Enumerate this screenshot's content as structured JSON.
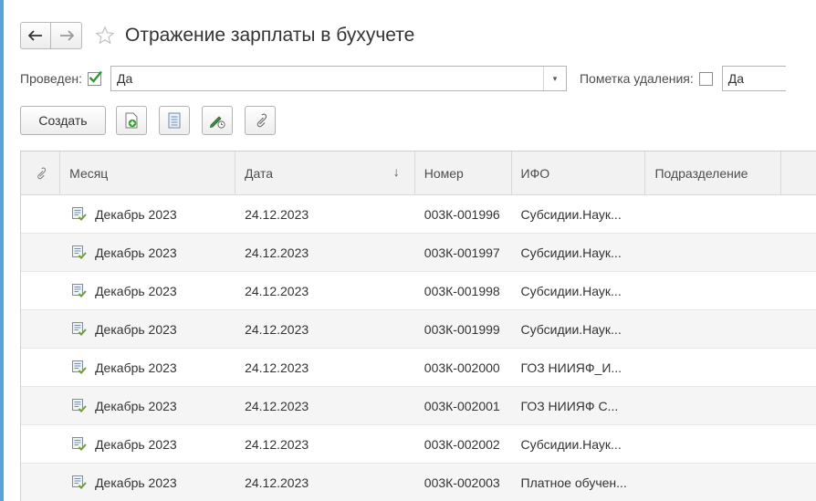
{
  "window": {
    "title": "Отражение зарплаты в бухучете"
  },
  "filters": {
    "posted_label": "Проведен:",
    "posted_checked": true,
    "posted_value": "Да",
    "deletion_label": "Пометка удаления:",
    "deletion_checked": false,
    "deletion_value": "Да"
  },
  "toolbar": {
    "create_label": "Создать",
    "icons": [
      "add-document-icon",
      "list-icon",
      "edit-date-icon",
      "attachment-icon"
    ]
  },
  "table": {
    "columns": {
      "attachment": "attachment-icon",
      "month": "Месяц",
      "date": "Дата",
      "number": "Номер",
      "ifo": "ИФО",
      "department": "Подразделение"
    },
    "sort_indicator": "↓",
    "rows": [
      {
        "month": "Декабрь 2023",
        "date": "24.12.2023",
        "number": "003К-001996",
        "ifo": "Субсидии.Наук..."
      },
      {
        "month": "Декабрь 2023",
        "date": "24.12.2023",
        "number": "003К-001997",
        "ifo": "Субсидии.Наук..."
      },
      {
        "month": "Декабрь 2023",
        "date": "24.12.2023",
        "number": "003К-001998",
        "ifo": "Субсидии.Наук..."
      },
      {
        "month": "Декабрь 2023",
        "date": "24.12.2023",
        "number": "003К-001999",
        "ifo": "Субсидии.Наук..."
      },
      {
        "month": "Декабрь 2023",
        "date": "24.12.2023",
        "number": "003К-002000",
        "ifo": "ГОЗ НИИЯФ_И..."
      },
      {
        "month": "Декабрь 2023",
        "date": "24.12.2023",
        "number": "003К-002001",
        "ifo": "ГОЗ НИИЯФ С..."
      },
      {
        "month": "Декабрь 2023",
        "date": "24.12.2023",
        "number": "003К-002002",
        "ifo": "Субсидии.Наук..."
      },
      {
        "month": "Декабрь 2023",
        "date": "24.12.2023",
        "number": "003К-002003",
        "ifo": "Платное обучен..."
      }
    ]
  },
  "colors": {
    "accent": "#5aa3d6",
    "check": "#2e9a2e",
    "posted_doc_icon": "#6f9f2c"
  }
}
